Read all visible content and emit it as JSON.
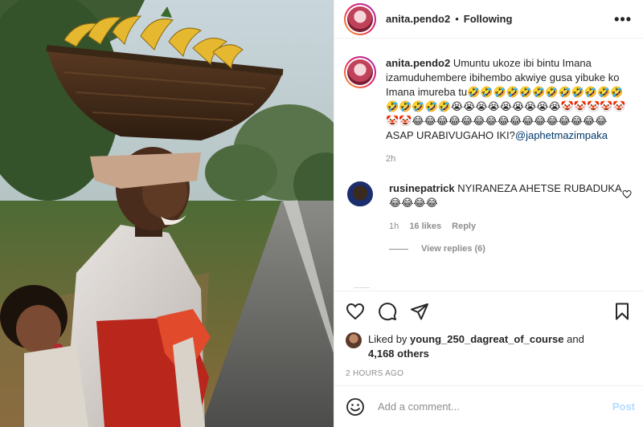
{
  "header": {
    "username": "anita.pendo2",
    "separator": "•",
    "follow_status": "Following",
    "more": "•••"
  },
  "caption": {
    "username": "anita.pendo2",
    "text": "Umuntu ukoze ibi bintu Imana izamuduhembere ibihembo akwiye gusa yibuke ko Imana imureba tu🤣🤣🤣🤣🤣🤣🤣🤣🤣🤣🤣🤣🤣🤣🤣🤣🤣😭😭😭😭😭😭😭😭😭🤡🤡🤡🤡🤡🤡🤡😂😂😂😂😂😂😂😂😂😂😂😂😂😂😂😂 ASAP URABIVUGAHO IKI?",
    "mention": "@japhetmazimpaka",
    "time": "2h"
  },
  "comment": {
    "username": "rusinepatrick",
    "text": "NYIRANEZA AHETSE RUBADUKA 😂😂😂😂",
    "time": "1h",
    "likes": "16 likes",
    "reply": "Reply",
    "view_replies": "View replies (6)"
  },
  "likes": {
    "prefix": "Liked by",
    "user": "young_250_dagreat_of_course",
    "joiner": "and",
    "others": "4,168 others"
  },
  "timestamp": "2 HOURS AGO",
  "add_comment": {
    "placeholder": "Add a comment...",
    "post": "Post"
  },
  "icons": {
    "like": "heart-icon",
    "comment": "comment-icon",
    "share": "paper-plane-icon",
    "save": "bookmark-icon",
    "emoji": "smiley-icon",
    "more": "more-icon"
  },
  "colors": {
    "text": "#262626",
    "secondary": "#8e8e8e",
    "link": "#00376b",
    "post_button": "#b3dbff",
    "border": "#efefef"
  }
}
